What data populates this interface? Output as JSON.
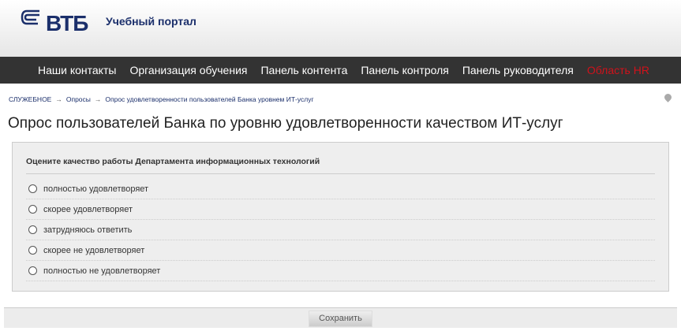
{
  "header": {
    "logo": "ВТБ",
    "portal_title": "Учебный портал"
  },
  "nav": {
    "items": [
      "Наши контакты",
      "Организация обучения",
      "Панель контента",
      "Панель контроля",
      "Панель руководителя",
      "Область HR"
    ]
  },
  "breadcrumb": [
    "СЛУЖЕБНОЕ",
    "Опросы",
    "Опрос удовлетворенности пользователей Банка уровнем ИТ-услуг"
  ],
  "breadcrumb_sep": "→",
  "page_title": "Опрос пользователей Банка по уровню удовлетворенности качеством ИТ-услуг",
  "question": {
    "text": "Оцените качество работы Департамента информационных технологий",
    "options": [
      "полностью удовлетворяет",
      "скорее удовлетворяет",
      "затрудняюсь ответить",
      "скорее не удовлетворяет",
      "полностью не удовлетворяет"
    ]
  },
  "save_label": "Сохранить",
  "colors": {
    "brand": "#1b2f6b",
    "nav_bg": "#333333",
    "hr": "#d0121b"
  }
}
